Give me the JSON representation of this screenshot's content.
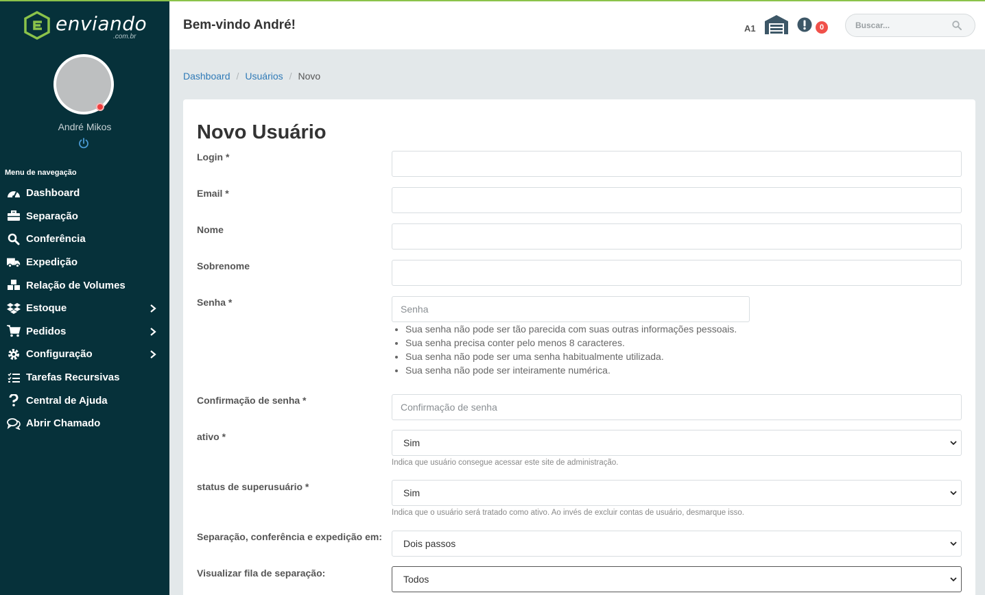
{
  "brand": {
    "name": "enviando",
    "domain": ".com.br"
  },
  "user": {
    "name": "André Mikos"
  },
  "sidebar": {
    "menu_title": "Menu de navegação",
    "items": [
      {
        "label": "Dashboard",
        "icon": "tachometer-icon"
      },
      {
        "label": "Separação",
        "icon": "briefcase-icon"
      },
      {
        "label": "Conferência",
        "icon": "search-icon"
      },
      {
        "label": "Expedição",
        "icon": "truck-icon"
      },
      {
        "label": "Relação de Volumes",
        "icon": "boxes-icon"
      },
      {
        "label": "Estoque",
        "icon": "dropbox-icon",
        "has_submenu": true
      },
      {
        "label": "Pedidos",
        "icon": "cart-icon",
        "has_submenu": true
      },
      {
        "label": "Configuração",
        "icon": "gear-icon",
        "has_submenu": true
      },
      {
        "label": "Tarefas Recursivas",
        "icon": "tasks-icon"
      },
      {
        "label": "Central de Ajuda",
        "icon": "question-icon"
      },
      {
        "label": "Abrir Chamado",
        "icon": "comments-icon"
      }
    ]
  },
  "header": {
    "welcome": "Bem-vindo André!",
    "warehouse_code": "A1",
    "alert_count": "0",
    "search_placeholder": "Buscar..."
  },
  "breadcrumb": {
    "items": [
      "Dashboard",
      "Usuários"
    ],
    "current": "Novo"
  },
  "form": {
    "title": "Novo Usuário",
    "login_label": "Login *",
    "email_label": "Email *",
    "nome_label": "Nome",
    "sobrenome_label": "Sobrenome",
    "senha_label": "Senha *",
    "senha_placeholder": "Senha",
    "senha_rules": [
      "Sua senha não pode ser tão parecida com suas outras informações pessoais.",
      "Sua senha precisa conter pelo menos 8 caracteres.",
      "Sua senha não pode ser uma senha habitualmente utilizada.",
      "Sua senha não pode ser inteiramente numérica."
    ],
    "confirm_label": "Confirmação de senha *",
    "confirm_placeholder": "Confirmação de senha",
    "ativo_label": "ativo *",
    "ativo_value": "Sim",
    "ativo_help": "Indica que usuário consegue acessar este site de administração.",
    "superuser_label": "status de superusuário *",
    "superuser_value": "Sim",
    "superuser_help": "Indica que o usuário será tratado como ativo. Ao invés de excluir contas de usuário, desmarque isso.",
    "separacao_label": "Separação, conferência e expedição em:",
    "separacao_value": "Dois passos",
    "fila_label": "Visualizar fila de separação:",
    "fila_value": "Todos"
  },
  "colors": {
    "sidebar_bg": "#06313a",
    "accent_green": "#8bc34a",
    "link_blue": "#2f7ab7",
    "badge_red": "#f0514a"
  }
}
